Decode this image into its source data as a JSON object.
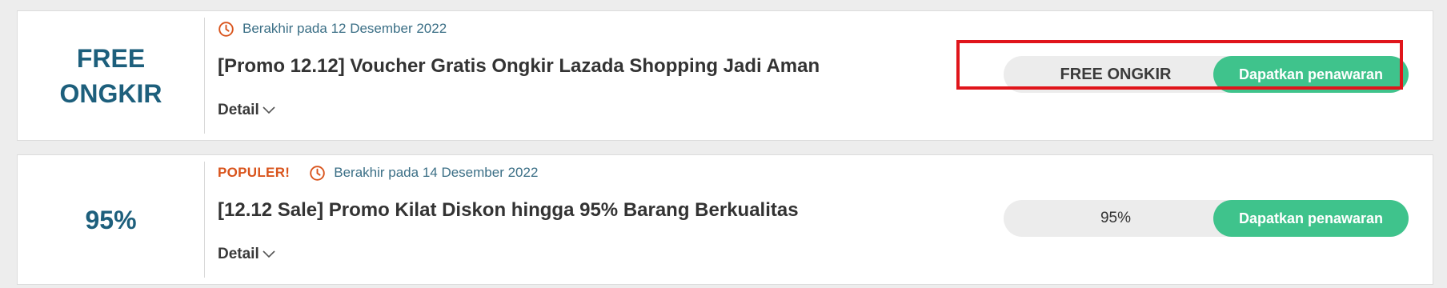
{
  "colors": {
    "accent": "#1d5f7c",
    "popular": "#d9541c",
    "cta": "#3fc38c",
    "highlight": "#e0151b"
  },
  "offers": [
    {
      "badge": "FREE ONGKIR",
      "popular_label": "",
      "expires": "Berakhir pada 12 Desember 2022",
      "title": "[Promo 12.12] Voucher Gratis Ongkir Lazada Shopping Jadi Aman",
      "detail": "Detail",
      "code": "FREE ONGKIR",
      "cta": "Dapatkan penawaran"
    },
    {
      "badge": "95%",
      "popular_label": "POPULER!",
      "expires": "Berakhir pada 14 Desember 2022",
      "title": "[12.12 Sale] Promo Kilat Diskon hingga 95% Barang Berkualitas",
      "detail": "Detail",
      "code": "95%",
      "cta": "Dapatkan penawaran"
    }
  ],
  "icons": {
    "clock": "clock-icon",
    "chevron": "chevron-down-icon"
  }
}
